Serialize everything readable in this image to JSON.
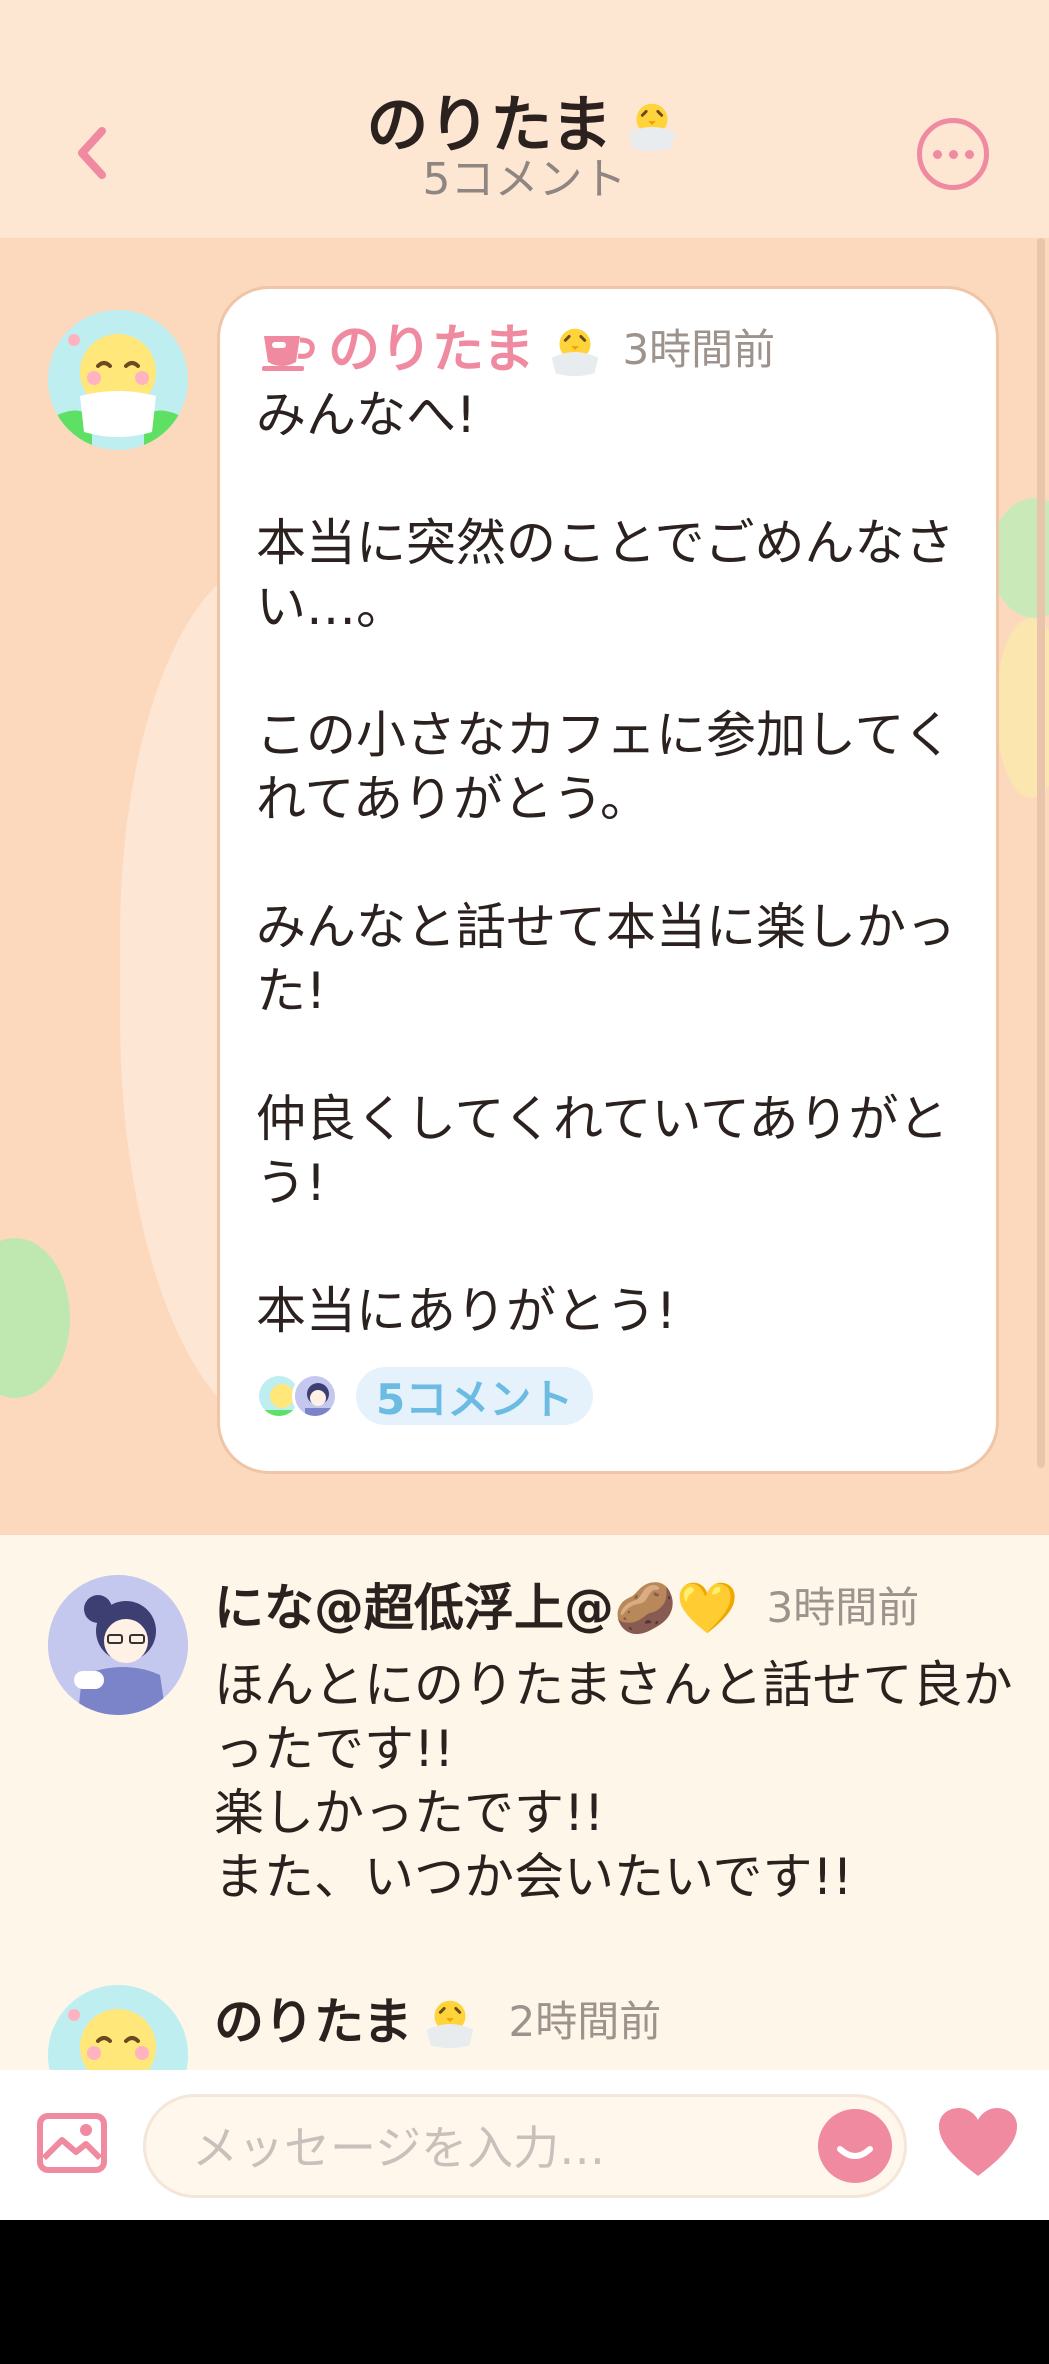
{
  "header": {
    "title": "のりたま",
    "subtitle": "5コメント"
  },
  "post": {
    "author": "のりたま",
    "time": "3時間前",
    "body": "みんなへ!\n\n本当に突然のことでごめんなさい…。\n\nこの小さなカフェに参加してくれてありがとう。\n\nみんなと話せて本当に楽しかった!\n\n仲良くしてくれていてありがとう!\n\n本当にありがとう!",
    "comment_count": "5コメント"
  },
  "comments": [
    {
      "author": "にな@超低浮上@🥔💛",
      "time": "3時間前",
      "body": "ほんとにのりたまさんと話せて良かったです!!\n楽しかったです!!\nまた、いつか会いたいです!!"
    },
    {
      "author": "のりたま",
      "time": "2時間前"
    }
  ],
  "input": {
    "placeholder": "メッセージを入力…"
  },
  "colors": {
    "accent": "#ef8aa0",
    "background": "#fcd9bd",
    "header_bg": "#fde7d2",
    "link_blue": "#6bbbe3"
  },
  "icons": {
    "back": "chevron-left-icon",
    "more": "more-icon",
    "cup": "cup-icon",
    "chick": "chick-icon",
    "image": "image-icon",
    "emoji": "smile-icon",
    "heart": "heart-icon"
  }
}
